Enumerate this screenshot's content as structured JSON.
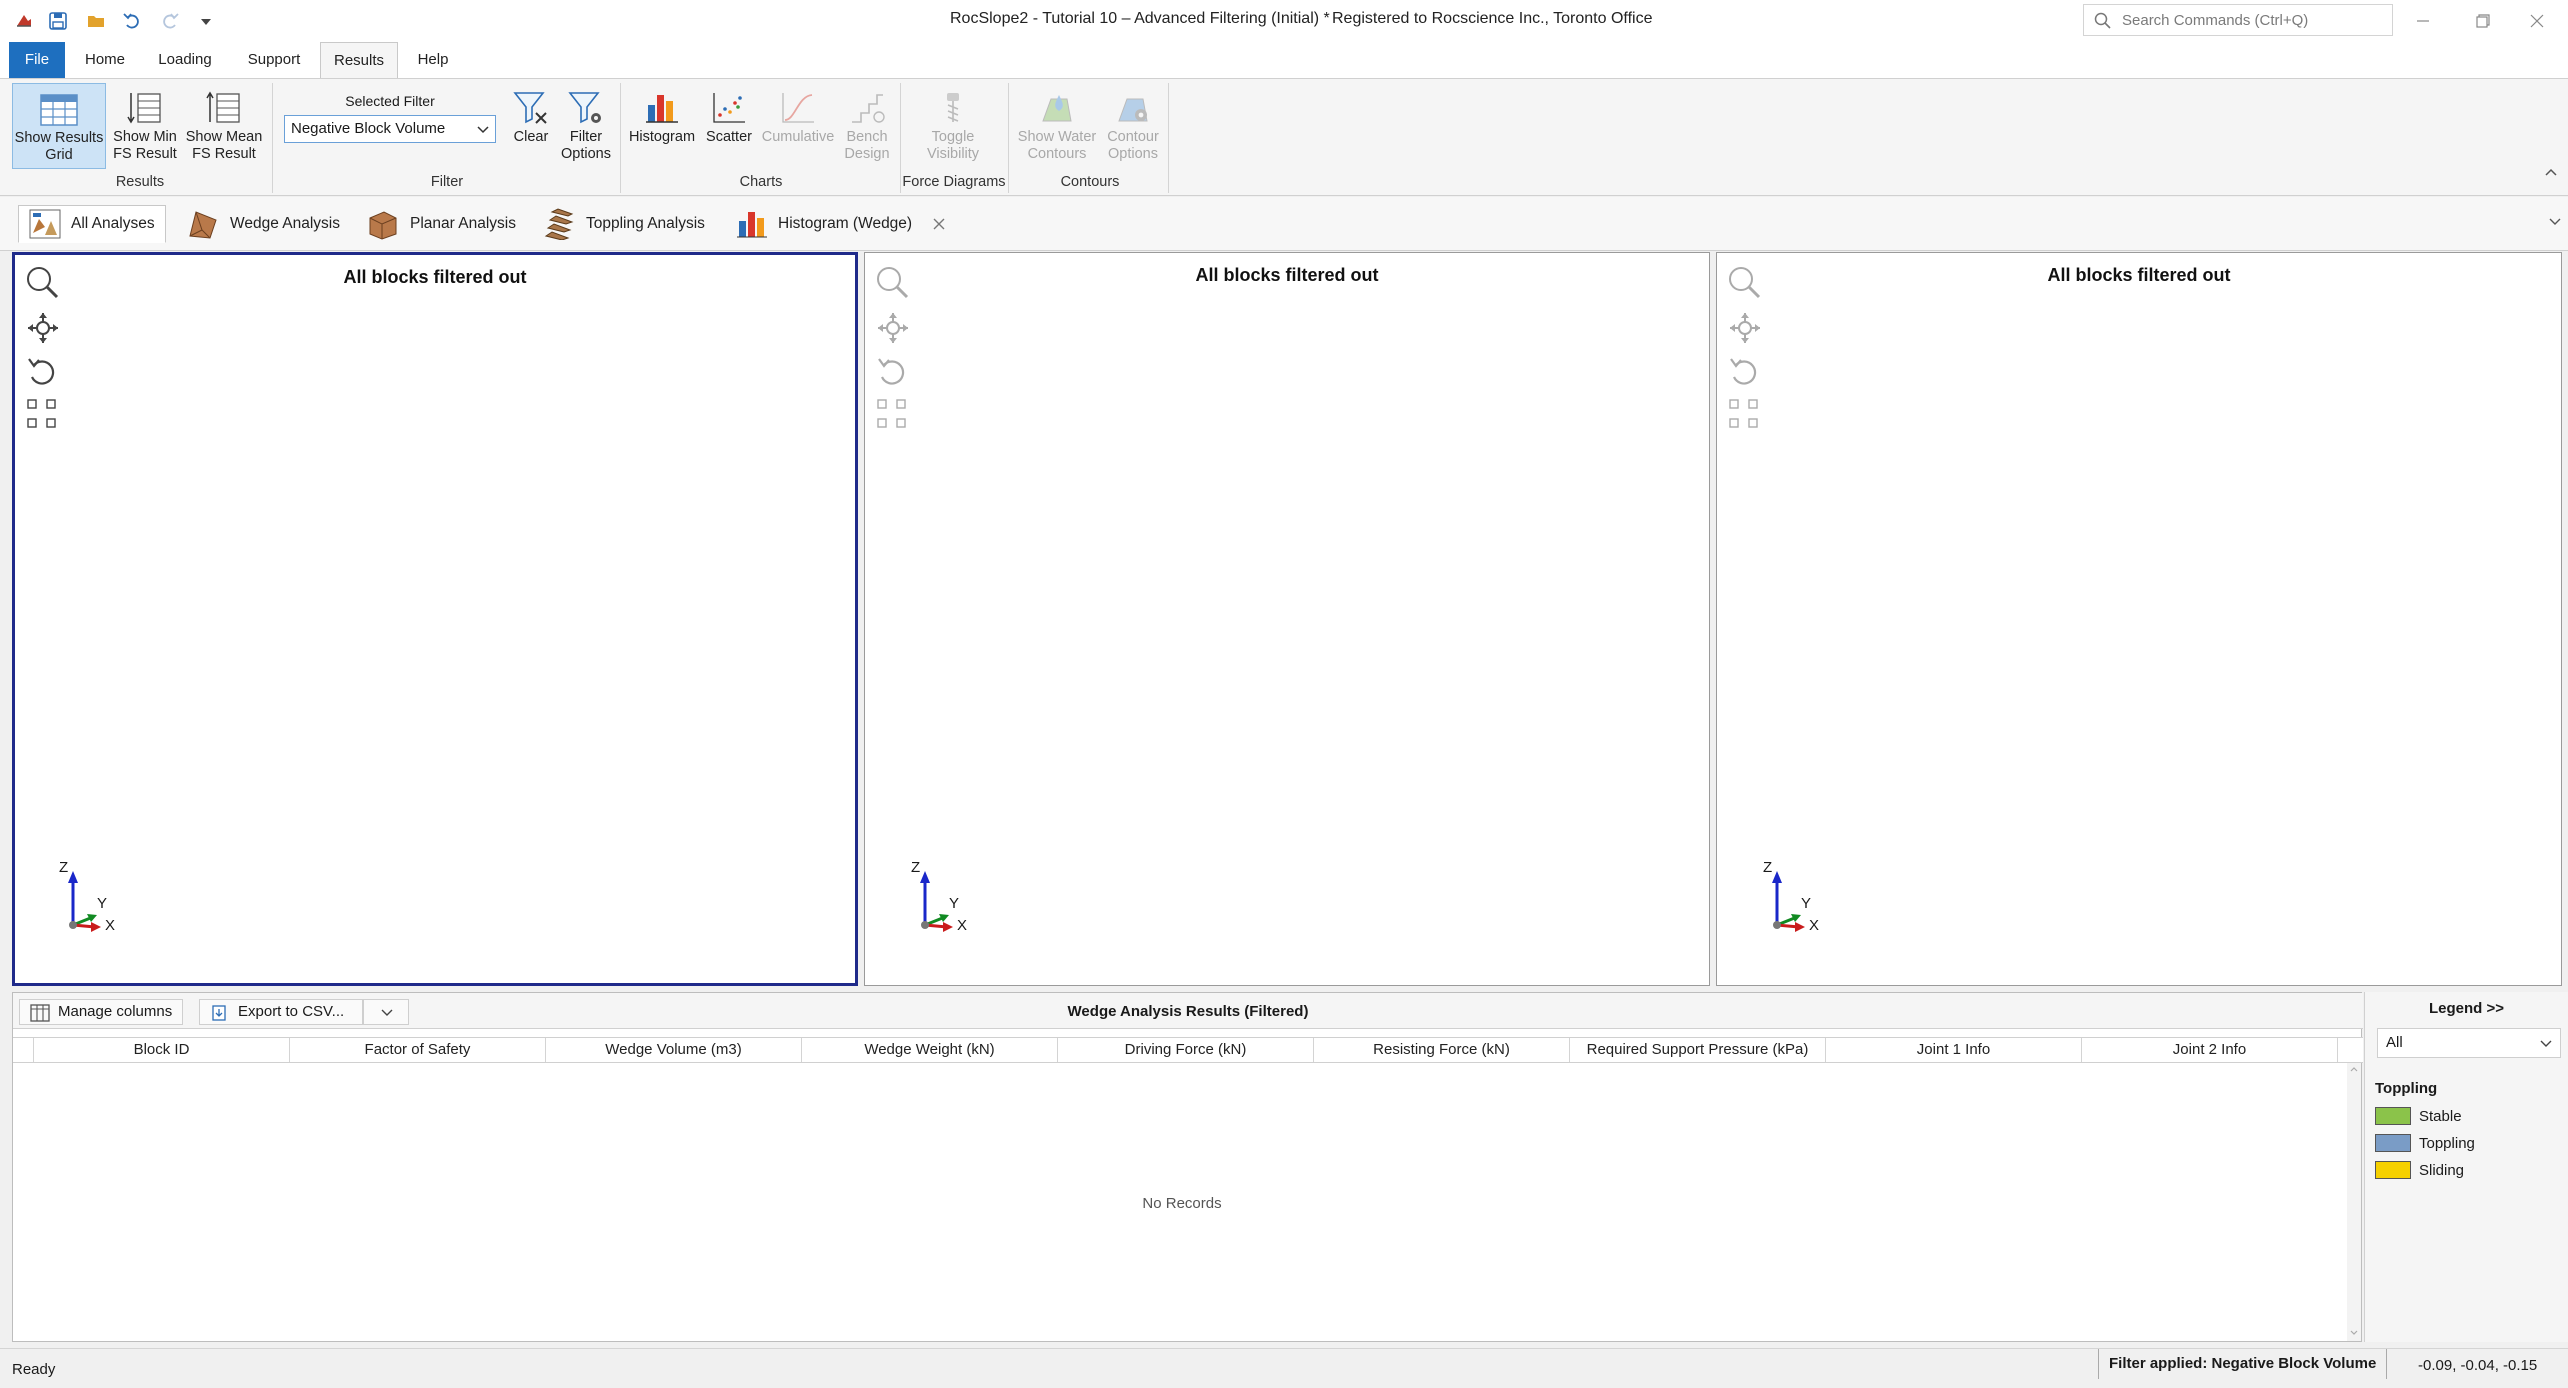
{
  "window": {
    "title": "RocSlope2 - Tutorial 10 – Advanced Filtering (Initial) *",
    "registered": "Registered to Rocscience Inc., Toronto Office",
    "search_placeholder": "Search Commands (Ctrl+Q)"
  },
  "menu": {
    "tabs": [
      "File",
      "Home",
      "Loading",
      "Support",
      "Results",
      "Help"
    ],
    "active": "Results"
  },
  "ribbon": {
    "results_group": {
      "label": "Results",
      "show_results_grid": "Show Results\nGrid",
      "show_min_fs": "Show Min\nFS Result",
      "show_mean_fs": "Show Mean\nFS Result"
    },
    "filter_group": {
      "label": "Filter",
      "selected_filter_label": "Selected Filter",
      "selected_filter_value": "Negative Block Volume",
      "clear": "Clear",
      "filter_options": "Filter\nOptions"
    },
    "charts_group": {
      "label": "Charts",
      "histogram": "Histogram",
      "scatter": "Scatter",
      "cumulative": "Cumulative",
      "bench_design": "Bench\nDesign"
    },
    "force_group": {
      "label": "Force Diagrams",
      "toggle_visibility": "Toggle\nVisibility"
    },
    "contours_group": {
      "label": "Contours",
      "show_water_contours": "Show Water\nContours",
      "contour_options": "Contour\nOptions"
    }
  },
  "doc_tabs": [
    "All Analyses",
    "Wedge Analysis",
    "Planar Analysis",
    "Toppling Analysis",
    "Histogram (Wedge)"
  ],
  "views": [
    {
      "message": "All blocks filtered out"
    },
    {
      "message": "All blocks filtered out"
    },
    {
      "message": "All blocks filtered out"
    }
  ],
  "axes": {
    "z": "Z",
    "y": "Y",
    "x": "X"
  },
  "results_panel": {
    "manage_columns": "Manage columns",
    "export_csv": "Export to CSV...",
    "title": "Wedge Analysis Results (Filtered)",
    "columns": [
      "Block ID",
      "Factor of Safety",
      "Wedge Volume (m3)",
      "Wedge Weight (kN)",
      "Driving Force (kN)",
      "Resisting Force (kN)",
      "Required Support Pressure (kPa)",
      "Joint 1 Info",
      "Joint 2 Info"
    ],
    "empty_text": "No Records"
  },
  "legend": {
    "title": "Legend >>",
    "selected": "All",
    "group": "Toppling",
    "items": [
      {
        "label": "Stable",
        "color": "#8bc34a"
      },
      {
        "label": "Toppling",
        "color": "#7a9cc6"
      },
      {
        "label": "Sliding",
        "color": "#f5d000"
      }
    ]
  },
  "status": {
    "ready": "Ready",
    "filter_applied": "Filter applied: Negative Block Volume",
    "coords": "-0.09, -0.04, -0.15"
  }
}
